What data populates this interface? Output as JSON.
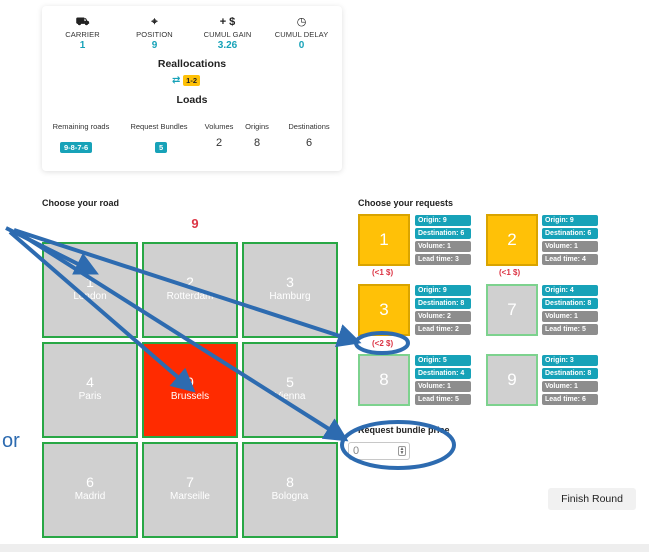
{
  "stats": [
    {
      "icon": "⛟",
      "icon_name": "truck-icon",
      "label": "CARRIER",
      "value": "1"
    },
    {
      "icon": "⌖",
      "icon_name": "crosshair-icon",
      "label": "POSITION",
      "value": "9"
    },
    {
      "icon": "+ $",
      "icon_name": "plus-dollar-icon",
      "label": "CUMUL GAIN",
      "value": "3.26"
    },
    {
      "icon": "◷",
      "icon_name": "clock-icon",
      "label": "CUMUL DELAY",
      "value": "0"
    }
  ],
  "reallocations": {
    "title": "Reallocations",
    "icon": "⇄",
    "badge": "1-2"
  },
  "loads": {
    "title": "Loads",
    "headers": [
      "Remaining roads",
      "Request Bundles",
      "Volumes",
      "Origins",
      "Destinations"
    ],
    "values": [
      "9-8-7-6",
      "5",
      "2",
      "8",
      "6"
    ]
  },
  "road": {
    "title": "Choose your road",
    "current": "9",
    "cities": [
      {
        "num": "1",
        "name": "London"
      },
      {
        "num": "2",
        "name": "Rotterdam"
      },
      {
        "num": "3",
        "name": "Hamburg"
      },
      {
        "num": "4",
        "name": "Paris"
      },
      {
        "num": "9",
        "name": "Brussels"
      },
      {
        "num": "5",
        "name": "Vienna"
      },
      {
        "num": "6",
        "name": "Madrid"
      },
      {
        "num": "7",
        "name": "Marseille"
      },
      {
        "num": "8",
        "name": "Bologna"
      }
    ]
  },
  "requests": {
    "title": "Choose your requests",
    "items": [
      {
        "id": "1",
        "origin": "Origin: 9",
        "destination": "Destination: 6",
        "volume": "Volume: 1",
        "lead": "Lead time: 3",
        "price": "(<1 $)"
      },
      {
        "id": "2",
        "origin": "Origin: 9",
        "destination": "Destination: 6",
        "volume": "Volume: 1",
        "lead": "Lead time: 4",
        "price": "(<1 $)"
      },
      {
        "id": "3",
        "origin": "Origin: 9",
        "destination": "Destination: 8",
        "volume": "Volume: 2",
        "lead": "Lead time: 2",
        "price": "(<2 $)"
      },
      {
        "id": "7",
        "origin": "Origin: 4",
        "destination": "Destination: 8",
        "volume": "Volume: 1",
        "lead": "Lead time: 5",
        "price": ""
      },
      {
        "id": "8",
        "origin": "Origin: 5",
        "destination": "Destination: 4",
        "volume": "Volume: 1",
        "lead": "Lead time: 5",
        "price": ""
      },
      {
        "id": "9",
        "origin": "Origin: 3",
        "destination": "Destination: 8",
        "volume": "Volume: 1",
        "lead": "Lead time: 6",
        "price": ""
      }
    ]
  },
  "bundle_price": {
    "label": "Request bundle price",
    "value": "0"
  },
  "finish_label": "Finish Round",
  "cut_text": "or",
  "colors": {
    "accent": "#17a2b8",
    "selected_city": "#ff2b00",
    "border_green": "#28a745",
    "selected_request": "#ffc107",
    "annotation": "#2d6bb0"
  }
}
